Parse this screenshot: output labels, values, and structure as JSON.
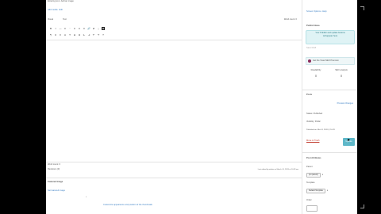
{
  "editor": {
    "title_crumb": "Entering text • Add an image",
    "crumb_links": [
      "Add media",
      "Edit"
    ],
    "tabs": [
      "Visual",
      "Text"
    ],
    "word_label": "Word count: 0",
    "status_left": "Word count: 0",
    "status_right": "Last edited by admin on March 14, 2019 at 10:28 am",
    "bottom_label": "Revisions (0)",
    "bottom_section_title": "Featured Image",
    "bottom_section_text": "Set featured image",
    "bottom_link": "Customize appearance and position of the thumbnails",
    "toolbar_row1": [
      "B",
      "I",
      "—",
      "≡",
      "“",
      "≡",
      "≡",
      "≡",
      "🔗",
      "⊘",
      "⋮",
      "⊞"
    ],
    "toolbar_row2": [
      "¶",
      "U",
      "≡",
      "A",
      "T",
      "⊟",
      "Ω",
      "⇤",
      "⇥",
      "↶",
      "↷",
      "?"
    ]
  },
  "sidebar": {
    "top_link": "Screen Options • Help",
    "publish_title": "Publish Ideas",
    "publish_hint_1": "Your Publish and update buttons",
    "publish_hint_2": "will appear here",
    "sep_text": "Save Draft",
    "seo_label": "Get the Yoast SEO Premium",
    "stat_left_value": "0",
    "stat_left_label": "Readability",
    "stat_right_value": "0",
    "stat_right_label": "SEO analysis",
    "posts_title": "Posts",
    "posts_link": "Preview Changes",
    "status_line": "Status: Published",
    "visibility_line": "Visibility: Public",
    "published_line": "Published on: Mar 14, 2019 @ 10:28",
    "trash_label": "Move to Trash",
    "update_label": "Update",
    "categories_title": "Post Attributes",
    "cat_label_1": "Parent",
    "cat_value_1": "(no parent)",
    "cat_label_2": "Template",
    "cat_value_2": "Default Template",
    "cat_label_3": "Order"
  },
  "colors": {
    "accent": "#3a7fc4",
    "update": "#5fb8c9",
    "panel": "#dff3f5",
    "trash": "#c0392b"
  }
}
